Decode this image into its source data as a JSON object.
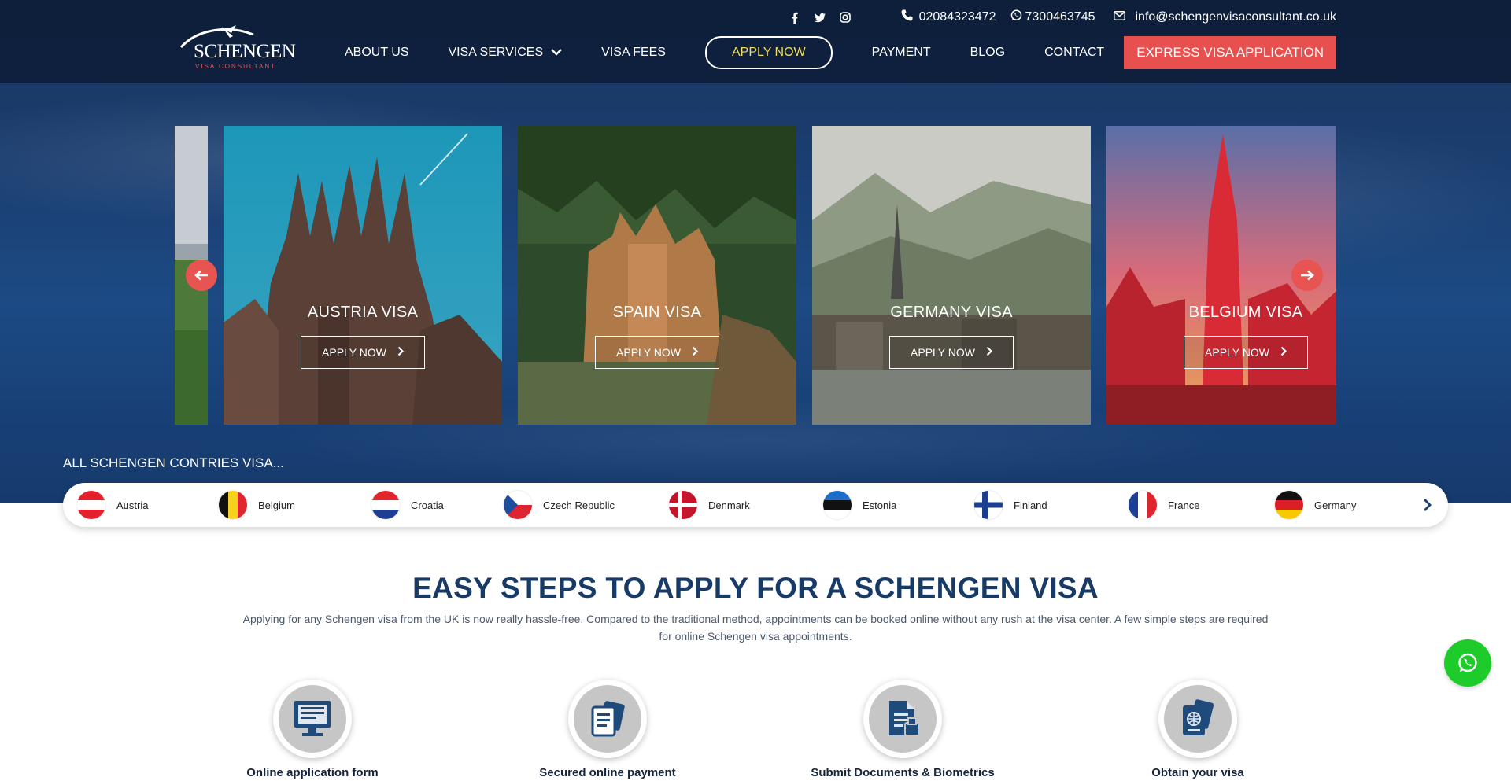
{
  "brand": {
    "logo_text": "SCHENGEN",
    "logo_sub": "VISA CONSULTANT"
  },
  "topbar": {
    "social": [
      "facebook-icon",
      "twitter-icon",
      "instagram-icon"
    ],
    "phone": "02084323472",
    "whatsapp": "7300463745",
    "email": "info@schengenvisaconsultant.co.uk"
  },
  "nav": {
    "items": [
      "ABOUT US",
      "VISA SERVICES",
      "VISA FEES"
    ],
    "apply_now": "APPLY NOW",
    "items_right": [
      "PAYMENT",
      "BLOG",
      "CONTACT"
    ],
    "express": "EXPRESS VISA APPLICATION"
  },
  "carousel": {
    "cards": [
      {
        "title": "AUSTRIA VISA",
        "button": "APPLY NOW"
      },
      {
        "title": "SPAIN VISA",
        "button": "APPLY NOW"
      },
      {
        "title": "GERMANY VISA",
        "button": "APPLY NOW"
      },
      {
        "title": "BELGIUM VISA",
        "button": "APPLY NOW"
      }
    ]
  },
  "countries": {
    "title": "ALL SCHENGEN CONTRIES VISA...",
    "items": [
      "Austria",
      "Belgium",
      "Croatia",
      "Czech Republic",
      "Denmark",
      "Estonia",
      "Finland",
      "France",
      "Germany"
    ]
  },
  "steps_section": {
    "title": "EASY STEPS TO APPLY FOR A SCHENGEN VISA",
    "description": "Applying for any Schengen visa from the UK is now really hassle-free. Compared to the traditional method, appointments can be booked online without any rush at the visa center. A few simple steps are required for online Schengen visa appointments.",
    "steps": [
      {
        "label": "Online application form",
        "icon": "monitor-form-icon"
      },
      {
        "label": "Secured online payment",
        "icon": "document-payment-icon"
      },
      {
        "label": "Submit Documents & Biometrics",
        "icon": "document-fingerprint-icon"
      },
      {
        "label": "Obtain your visa",
        "icon": "passport-icon"
      }
    ]
  },
  "colors": {
    "accent_red": "#e8504f",
    "navy": "#173a66",
    "apply_yellow": "#f2dd5a",
    "whatsapp_green": "#1dcc2a"
  }
}
